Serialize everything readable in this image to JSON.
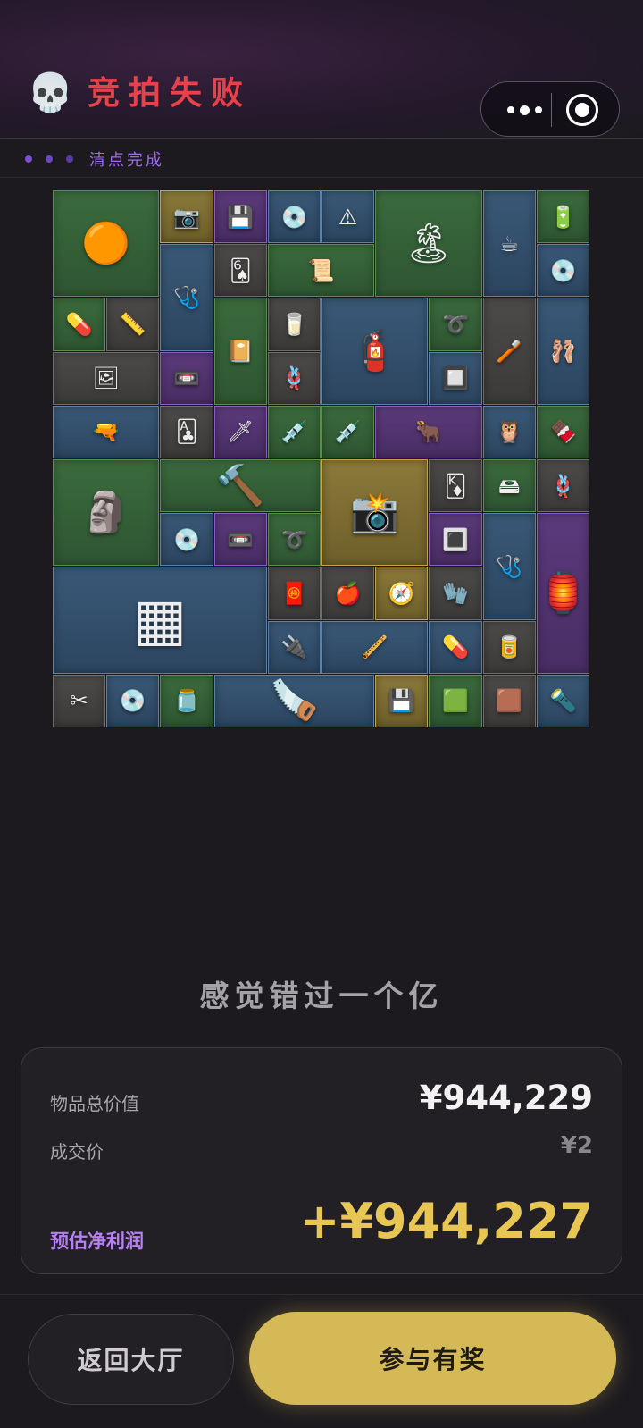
{
  "header": {
    "skull_icon": "💀",
    "title": "竞拍失败"
  },
  "capsule": {
    "more_icon": "more-dots-icon",
    "target_icon": "target-icon"
  },
  "status": {
    "text": "清点完成"
  },
  "grid_items": [
    {
      "name": "rug-plate",
      "color": "green",
      "glyph": "🟠"
    },
    {
      "name": "compact-camera",
      "color": "gold",
      "glyph": "📷"
    },
    {
      "name": "usb-stick",
      "color": "purple",
      "glyph": "💾"
    },
    {
      "name": "disc",
      "color": "blue",
      "glyph": "💿"
    },
    {
      "name": "warning-sign",
      "color": "blue",
      "glyph": "⚠"
    },
    {
      "name": "vintage-poster",
      "color": "green",
      "glyph": "🏝"
    },
    {
      "name": "moka-pot",
      "color": "blue",
      "glyph": "☕"
    },
    {
      "name": "battery-pack",
      "color": "green",
      "glyph": "🔋"
    },
    {
      "name": "stethoscope",
      "color": "blue",
      "glyph": "🩺"
    },
    {
      "name": "playing-card",
      "color": "gray",
      "glyph": "🂦"
    },
    {
      "name": "blueprint",
      "color": "green",
      "glyph": "📜"
    },
    {
      "name": "disc-blue",
      "color": "blue",
      "glyph": "💿"
    },
    {
      "name": "pill-bottle",
      "color": "green",
      "glyph": "💊"
    },
    {
      "name": "tape-measure",
      "color": "gray",
      "glyph": "📏"
    },
    {
      "name": "leather-notebook",
      "color": "green",
      "glyph": "📔"
    },
    {
      "name": "yogurt",
      "color": "gray",
      "glyph": "🥛"
    },
    {
      "name": "gas-cylinder",
      "color": "blue",
      "glyph": "🧯"
    },
    {
      "name": "hose",
      "color": "green",
      "glyph": "➰"
    },
    {
      "name": "toothpaste",
      "color": "gray",
      "glyph": "🪥"
    },
    {
      "name": "ballerina-statue",
      "color": "blue",
      "glyph": "🩰"
    },
    {
      "name": "old-photo",
      "color": "gray",
      "glyph": "🖼"
    },
    {
      "name": "cassette",
      "color": "purple",
      "glyph": "📼"
    },
    {
      "name": "rope",
      "color": "gray",
      "glyph": "🪢"
    },
    {
      "name": "battery",
      "color": "blue",
      "glyph": "🔲"
    },
    {
      "name": "rifle",
      "color": "blue",
      "glyph": "🔫"
    },
    {
      "name": "playing-card-clubs",
      "color": "gray",
      "glyph": "🃑"
    },
    {
      "name": "spear-head",
      "color": "purple",
      "glyph": "🗡"
    },
    {
      "name": "syringe",
      "color": "green",
      "glyph": "💉"
    },
    {
      "name": "syringe-2",
      "color": "green",
      "glyph": "💉"
    },
    {
      "name": "horns",
      "color": "purple",
      "glyph": "🐂"
    },
    {
      "name": "bird-figurine",
      "color": "blue",
      "glyph": "🦉"
    },
    {
      "name": "chocolate-bar",
      "color": "green",
      "glyph": "🍫"
    },
    {
      "name": "sphinx-statue",
      "color": "green",
      "glyph": "🗿"
    },
    {
      "name": "sledgehammer",
      "color": "green",
      "glyph": "🔨"
    },
    {
      "name": "medium-format-camera",
      "color": "gold",
      "glyph": "📸"
    },
    {
      "name": "playing-card-diamond",
      "color": "gray",
      "glyph": "🃎"
    },
    {
      "name": "hard-drive",
      "color": "green",
      "glyph": "🖴"
    },
    {
      "name": "rope-2",
      "color": "gray",
      "glyph": "🪢"
    },
    {
      "name": "disc-3",
      "color": "blue",
      "glyph": "💿"
    },
    {
      "name": "cassette-2",
      "color": "purple",
      "glyph": "📼"
    },
    {
      "name": "hose-2",
      "color": "green",
      "glyph": "➰"
    },
    {
      "name": "cpu-chip",
      "color": "purple",
      "glyph": "🔳"
    },
    {
      "name": "stethoscope-2",
      "color": "blue",
      "glyph": "🩺"
    },
    {
      "name": "lantern",
      "color": "purple",
      "glyph": "🏮"
    },
    {
      "name": "solar-panel",
      "color": "blue",
      "glyph": "▦"
    },
    {
      "name": "tin-box",
      "color": "gray",
      "glyph": "🧧"
    },
    {
      "name": "apple",
      "color": "gray",
      "glyph": "🍎"
    },
    {
      "name": "compass",
      "color": "gold",
      "glyph": "🧭"
    },
    {
      "name": "glove",
      "color": "gray",
      "glyph": "🧤"
    },
    {
      "name": "usb-drive",
      "color": "blue",
      "glyph": "🔌"
    },
    {
      "name": "smoking-pipe",
      "color": "blue",
      "glyph": "🪈"
    },
    {
      "name": "pill-blister",
      "color": "blue",
      "glyph": "💊"
    },
    {
      "name": "protein-tin",
      "color": "gray",
      "glyph": "🥫"
    },
    {
      "name": "scissors",
      "color": "gray",
      "glyph": "✂"
    },
    {
      "name": "disc-4",
      "color": "blue",
      "glyph": "💿"
    },
    {
      "name": "coffee-jar",
      "color": "green",
      "glyph": "🫙"
    },
    {
      "name": "saw",
      "color": "blue",
      "glyph": "🪚"
    },
    {
      "name": "ssd",
      "color": "gold",
      "glyph": "💾"
    },
    {
      "name": "circuit-board",
      "color": "green",
      "glyph": "🟩"
    },
    {
      "name": "matchbox",
      "color": "gray",
      "glyph": "🟫"
    },
    {
      "name": "flashlight",
      "color": "blue",
      "glyph": "🔦"
    }
  ],
  "tagline": "感觉错过一个亿",
  "summary": {
    "total_label": "物品总价值",
    "total_value": "¥944,229",
    "deal_label": "成交价",
    "deal_value": "¥2",
    "profit_label": "预估净利润",
    "profit_value": "+¥944,227"
  },
  "buttons": {
    "back": "返回大厅",
    "join": "参与有奖"
  },
  "colors": {
    "title_red": "#e8414a",
    "accent_purple": "#b77ef6",
    "gold": "#d6b957"
  }
}
